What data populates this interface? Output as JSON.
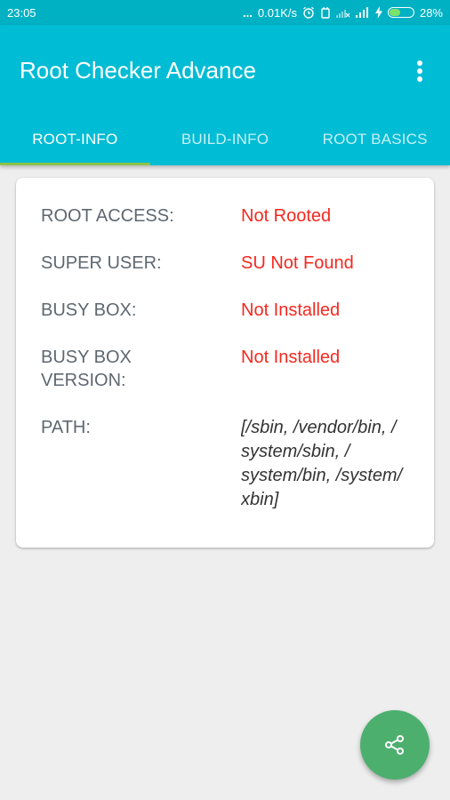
{
  "status_bar": {
    "time": "23:05",
    "dots": "...",
    "network_speed": "0.01K/s",
    "battery_percent": "28%",
    "battery_level": 0.28,
    "icons": [
      "alarm-icon",
      "device-icon",
      "signal-x-icon",
      "signal-icon",
      "charging-icon",
      "battery-icon"
    ]
  },
  "app_bar": {
    "title": "Root Checker Advance",
    "menu_icon": "more-vert-icon"
  },
  "tabs": [
    {
      "label": "ROOT-INFO",
      "active": true
    },
    {
      "label": "BUILD-INFO",
      "active": false
    },
    {
      "label": "ROOT BASICS",
      "active": false
    }
  ],
  "root_info": {
    "rows": [
      {
        "label": "ROOT ACCESS:",
        "value": "Not Rooted"
      },
      {
        "label": "SUPER USER:",
        "value": "SU Not Found"
      },
      {
        "label": "BUSY BOX:",
        "value": "Not Installed"
      },
      {
        "label": "BUSY BOX\nVERSION:",
        "value": "Not Installed"
      },
      {
        "label": "PATH:",
        "value": "[/sbin, /vendor/bin, /\nsystem/sbin, /\nsystem/bin, /system/\nxbin]"
      }
    ]
  },
  "fab": {
    "icon": "share-icon"
  },
  "colors": {
    "app_bar": "#00bcd4",
    "tab_indicator": "#8bc34a",
    "error_text": "#f5281f",
    "fab": "#4caf6e"
  }
}
